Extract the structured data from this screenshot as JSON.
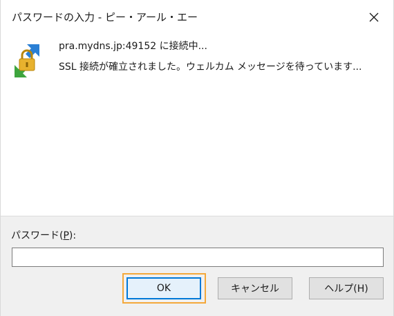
{
  "window": {
    "title": "パスワードの入力 - ピー・アール・エー"
  },
  "status": {
    "line1": "pra.mydns.jp:49152 に接続中...",
    "line2": "SSL 接続が確立されました。ウェルカム メッセージを待っています...",
    "icon": "secure-connection-lock-icon"
  },
  "password": {
    "label_prefix": "パスワード(",
    "label_key": "P",
    "label_suffix": "):",
    "value": "",
    "placeholder": ""
  },
  "buttons": {
    "ok": "OK",
    "cancel": "キャンセル",
    "help": "ヘルプ(H)"
  },
  "colors": {
    "focus_outline": "#f4a83a",
    "default_button_border": "#0078d7",
    "panel_background": "#f0f0f0"
  }
}
